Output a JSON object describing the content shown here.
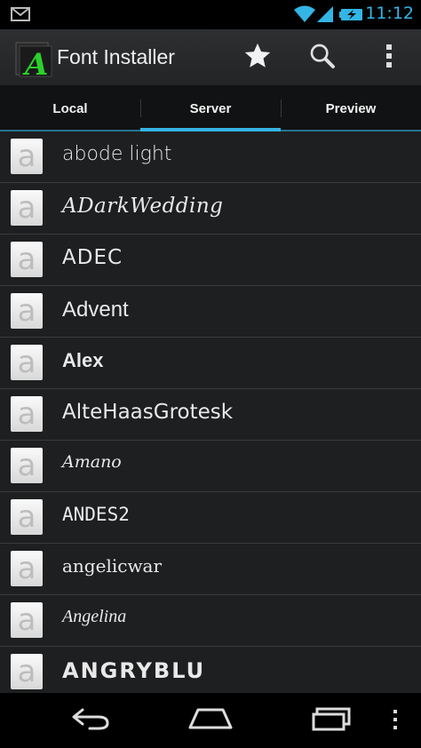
{
  "status_bar": {
    "time": "11:12",
    "icons": [
      "mail-icon",
      "wifi-icon",
      "signal-icon",
      "battery-charging-icon"
    ],
    "accent_color": "#33b5e5"
  },
  "action_bar": {
    "app_title": "Font Installer",
    "logo_letter": "A",
    "actions": [
      "star-icon",
      "search-icon",
      "overflow-menu-icon"
    ]
  },
  "tabs": [
    {
      "label": "Local",
      "selected": false
    },
    {
      "label": "Server",
      "selected": true
    },
    {
      "label": "Preview",
      "selected": false
    }
  ],
  "fonts": {
    "thumb_letter": "a",
    "items": [
      {
        "name": "abode light"
      },
      {
        "name": "ADarkWedding"
      },
      {
        "name": "ADEC"
      },
      {
        "name": "Advent"
      },
      {
        "name": "Alex"
      },
      {
        "name": "AlteHaasGrotesk"
      },
      {
        "name": "Amano"
      },
      {
        "name": "ANDES2"
      },
      {
        "name": "angelicwar"
      },
      {
        "name": "Angelina"
      },
      {
        "name": "ANGRYBLU"
      }
    ]
  },
  "nav_bar": {
    "buttons": [
      "back-icon",
      "home-icon",
      "recent-apps-icon",
      "menu-icon"
    ]
  }
}
